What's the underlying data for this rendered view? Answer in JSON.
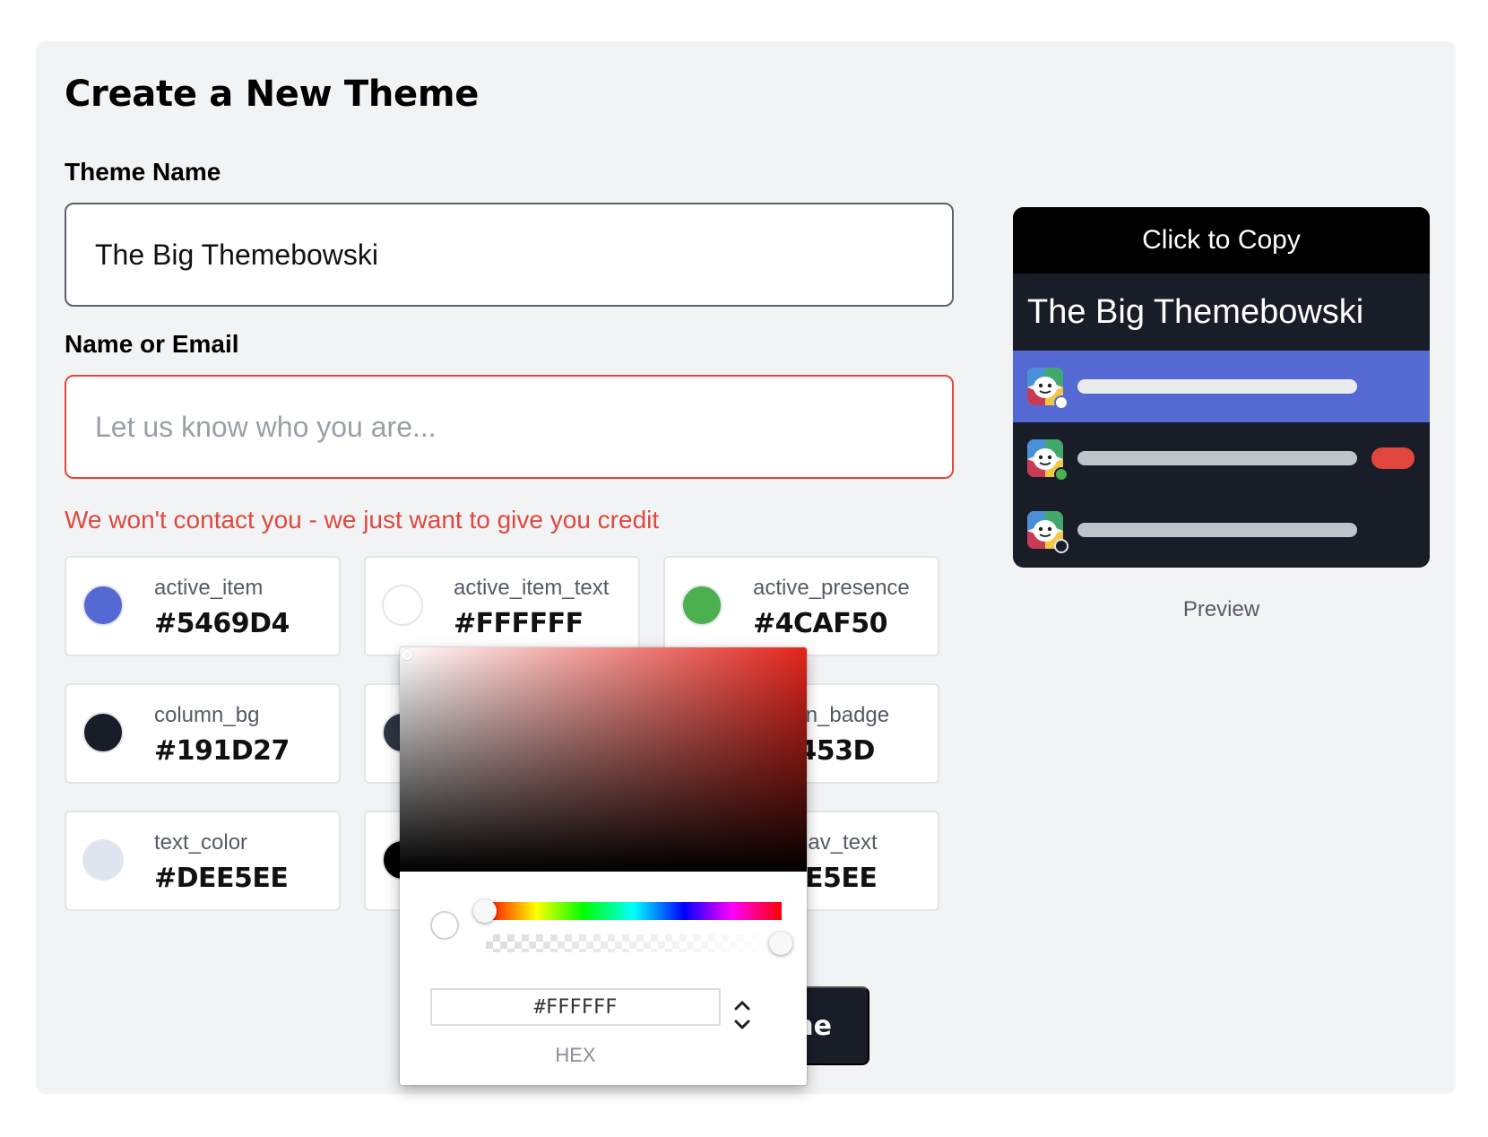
{
  "page": {
    "title": "Create a New Theme"
  },
  "form": {
    "theme_name": {
      "label": "Theme Name",
      "value": "The Big Themebowski"
    },
    "name_or_email": {
      "label": "Name or Email",
      "placeholder": "Let us know who you are...",
      "error": "We won't contact you - we just want to give you credit"
    },
    "submit_label_visible": "me"
  },
  "swatches": [
    {
      "name": "active_item",
      "hex": "#5469D4",
      "color": "#5469D4"
    },
    {
      "name": "active_item_text",
      "hex": "#FFFFFF",
      "color": "#FFFFFF"
    },
    {
      "name": "active_presence",
      "hex": "#4CAF50",
      "color": "#4CAF50"
    },
    {
      "name": "column_bg",
      "hex": "#191D27",
      "color": "#191D27"
    },
    {
      "name": "",
      "hex": "",
      "color": "#2E3440"
    },
    {
      "name": "ntion_badge",
      "hex": "2453D",
      "color": "#E2453D"
    },
    {
      "name": "text_color",
      "hex": "#DEE5EE",
      "color": "#DEE5EE"
    },
    {
      "name": "",
      "hex": "",
      "color": "#000000"
    },
    {
      "name": "nav_text",
      "hex": "EE5EE",
      "color": "#DEE5EE"
    }
  ],
  "preview": {
    "copy_label": "Click to Copy",
    "theme_name": "The Big Themebowski",
    "caption": "Preview",
    "colors": {
      "column_bg": "#191D27",
      "active_item": "#5469D4",
      "active_item_text": "#FFFFFF",
      "inactive_bar": "#BFC3CA",
      "presence_online": "#4CAF50",
      "mention_badge": "#E2453D"
    },
    "rows": [
      {
        "state": "active",
        "presence": "white"
      },
      {
        "state": "normal",
        "presence": "online",
        "badge": true
      },
      {
        "state": "normal",
        "presence": "away"
      }
    ]
  },
  "color_picker": {
    "hex_value": "#FFFFFF",
    "format_label": "HEX",
    "hue_color": "#E3251C",
    "alpha": 1
  }
}
